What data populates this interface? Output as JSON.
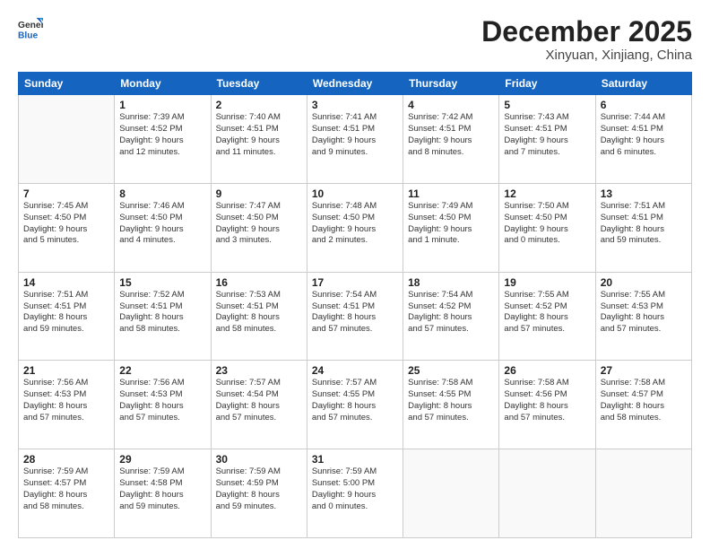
{
  "header": {
    "logo_general": "General",
    "logo_blue": "Blue",
    "month": "December 2025",
    "location": "Xinyuan, Xinjiang, China"
  },
  "days_of_week": [
    "Sunday",
    "Monday",
    "Tuesday",
    "Wednesday",
    "Thursday",
    "Friday",
    "Saturday"
  ],
  "weeks": [
    [
      {
        "day": "",
        "info": ""
      },
      {
        "day": "1",
        "info": "Sunrise: 7:39 AM\nSunset: 4:52 PM\nDaylight: 9 hours\nand 12 minutes."
      },
      {
        "day": "2",
        "info": "Sunrise: 7:40 AM\nSunset: 4:51 PM\nDaylight: 9 hours\nand 11 minutes."
      },
      {
        "day": "3",
        "info": "Sunrise: 7:41 AM\nSunset: 4:51 PM\nDaylight: 9 hours\nand 9 minutes."
      },
      {
        "day": "4",
        "info": "Sunrise: 7:42 AM\nSunset: 4:51 PM\nDaylight: 9 hours\nand 8 minutes."
      },
      {
        "day": "5",
        "info": "Sunrise: 7:43 AM\nSunset: 4:51 PM\nDaylight: 9 hours\nand 7 minutes."
      },
      {
        "day": "6",
        "info": "Sunrise: 7:44 AM\nSunset: 4:51 PM\nDaylight: 9 hours\nand 6 minutes."
      }
    ],
    [
      {
        "day": "7",
        "info": "Sunrise: 7:45 AM\nSunset: 4:50 PM\nDaylight: 9 hours\nand 5 minutes."
      },
      {
        "day": "8",
        "info": "Sunrise: 7:46 AM\nSunset: 4:50 PM\nDaylight: 9 hours\nand 4 minutes."
      },
      {
        "day": "9",
        "info": "Sunrise: 7:47 AM\nSunset: 4:50 PM\nDaylight: 9 hours\nand 3 minutes."
      },
      {
        "day": "10",
        "info": "Sunrise: 7:48 AM\nSunset: 4:50 PM\nDaylight: 9 hours\nand 2 minutes."
      },
      {
        "day": "11",
        "info": "Sunrise: 7:49 AM\nSunset: 4:50 PM\nDaylight: 9 hours\nand 1 minute."
      },
      {
        "day": "12",
        "info": "Sunrise: 7:50 AM\nSunset: 4:50 PM\nDaylight: 9 hours\nand 0 minutes."
      },
      {
        "day": "13",
        "info": "Sunrise: 7:51 AM\nSunset: 4:51 PM\nDaylight: 8 hours\nand 59 minutes."
      }
    ],
    [
      {
        "day": "14",
        "info": "Sunrise: 7:51 AM\nSunset: 4:51 PM\nDaylight: 8 hours\nand 59 minutes."
      },
      {
        "day": "15",
        "info": "Sunrise: 7:52 AM\nSunset: 4:51 PM\nDaylight: 8 hours\nand 58 minutes."
      },
      {
        "day": "16",
        "info": "Sunrise: 7:53 AM\nSunset: 4:51 PM\nDaylight: 8 hours\nand 58 minutes."
      },
      {
        "day": "17",
        "info": "Sunrise: 7:54 AM\nSunset: 4:51 PM\nDaylight: 8 hours\nand 57 minutes."
      },
      {
        "day": "18",
        "info": "Sunrise: 7:54 AM\nSunset: 4:52 PM\nDaylight: 8 hours\nand 57 minutes."
      },
      {
        "day": "19",
        "info": "Sunrise: 7:55 AM\nSunset: 4:52 PM\nDaylight: 8 hours\nand 57 minutes."
      },
      {
        "day": "20",
        "info": "Sunrise: 7:55 AM\nSunset: 4:53 PM\nDaylight: 8 hours\nand 57 minutes."
      }
    ],
    [
      {
        "day": "21",
        "info": "Sunrise: 7:56 AM\nSunset: 4:53 PM\nDaylight: 8 hours\nand 57 minutes."
      },
      {
        "day": "22",
        "info": "Sunrise: 7:56 AM\nSunset: 4:53 PM\nDaylight: 8 hours\nand 57 minutes."
      },
      {
        "day": "23",
        "info": "Sunrise: 7:57 AM\nSunset: 4:54 PM\nDaylight: 8 hours\nand 57 minutes."
      },
      {
        "day": "24",
        "info": "Sunrise: 7:57 AM\nSunset: 4:55 PM\nDaylight: 8 hours\nand 57 minutes."
      },
      {
        "day": "25",
        "info": "Sunrise: 7:58 AM\nSunset: 4:55 PM\nDaylight: 8 hours\nand 57 minutes."
      },
      {
        "day": "26",
        "info": "Sunrise: 7:58 AM\nSunset: 4:56 PM\nDaylight: 8 hours\nand 57 minutes."
      },
      {
        "day": "27",
        "info": "Sunrise: 7:58 AM\nSunset: 4:57 PM\nDaylight: 8 hours\nand 58 minutes."
      }
    ],
    [
      {
        "day": "28",
        "info": "Sunrise: 7:59 AM\nSunset: 4:57 PM\nDaylight: 8 hours\nand 58 minutes."
      },
      {
        "day": "29",
        "info": "Sunrise: 7:59 AM\nSunset: 4:58 PM\nDaylight: 8 hours\nand 59 minutes."
      },
      {
        "day": "30",
        "info": "Sunrise: 7:59 AM\nSunset: 4:59 PM\nDaylight: 8 hours\nand 59 minutes."
      },
      {
        "day": "31",
        "info": "Sunrise: 7:59 AM\nSunset: 5:00 PM\nDaylight: 9 hours\nand 0 minutes."
      },
      {
        "day": "",
        "info": ""
      },
      {
        "day": "",
        "info": ""
      },
      {
        "day": "",
        "info": ""
      }
    ]
  ]
}
